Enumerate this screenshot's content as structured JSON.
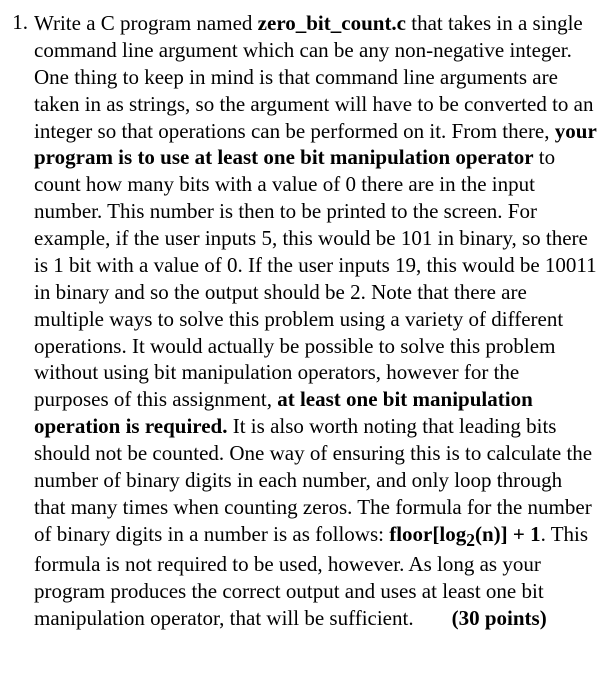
{
  "item": {
    "number": "1.",
    "t1": "Write a C program named ",
    "prog": "zero_bit_count.c",
    "t2": " that takes in a single command line argument which can be any non-negative integer. One thing to keep in mind is that command line arguments are taken in as strings, so the argument will have to be converted to an integer so that operations can be performed on it. From there, ",
    "b1": "your program is to use at least one bit manipulation operator",
    "t3": " to count how many bits with a value of 0 there are in the input number. This number is then to be printed to the screen. For example, if the user inputs 5, this would be 101 in binary, so there is 1 bit with a value of 0. If the user inputs 19, this would be 10011 in binary and so the output should be 2. Note that there are multiple ways to solve this problem using a variety of different operations. It would actually be possible to solve this problem without using bit manipulation operators, however for the purposes of this assignment, ",
    "b2": "at least one bit manipulation operation is required.",
    "t4": "  It is also worth noting that leading bits should not be counted.  One way of ensuring this is to calculate the number of binary digits in each number, and only loop through that many times when counting zeros.  The formula for the number of binary digits in a number is as follows:  ",
    "f1": "floor[log",
    "fsub": "2",
    "f2": "(n)] + 1",
    "t5": ".  This formula is not required to be used, however.  As long as your program produces the correct output and uses at least one bit manipulation operator, that will be sufficient.",
    "points": "(30 points)"
  }
}
